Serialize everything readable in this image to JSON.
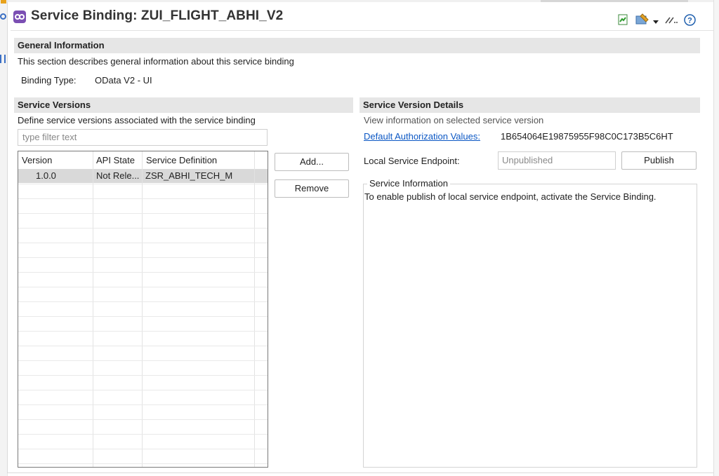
{
  "editor": {
    "title": "Service Binding: ZUI_FLIGHT_ABHI_V2"
  },
  "general": {
    "header": "General Information",
    "description": "This section describes general information about this service binding",
    "binding_type_label": "Binding Type:",
    "binding_type_value": "OData V2 - UI"
  },
  "versions": {
    "header": "Service Versions",
    "description": "Define service versions associated with the service binding",
    "filter_placeholder": "type filter text",
    "columns": [
      "Version",
      "API State",
      "Service Definition"
    ],
    "rows": [
      {
        "version": "1.0.0",
        "api_state": "Not Rele...",
        "service_definition": "ZSR_ABHI_TECH_M"
      }
    ],
    "add_label": "Add...",
    "remove_label": "Remove"
  },
  "details": {
    "header": "Service Version Details",
    "description": "View information on selected service version",
    "auth_link": "Default Authorization Values:",
    "auth_value": "1B654064E19875955F98C0C173B5C6HT",
    "endpoint_label": "Local Service Endpoint:",
    "endpoint_value": "Unpublished",
    "publish_label": "Publish",
    "info_title": "Service Information",
    "info_text": "To enable publish of local service endpoint, activate the Service Binding."
  },
  "colors": {
    "title_icon": "#7b4fb3",
    "link": "#0b57c4",
    "section_bar": "#e6e6e6",
    "selected_row": "#d9d9d9"
  }
}
